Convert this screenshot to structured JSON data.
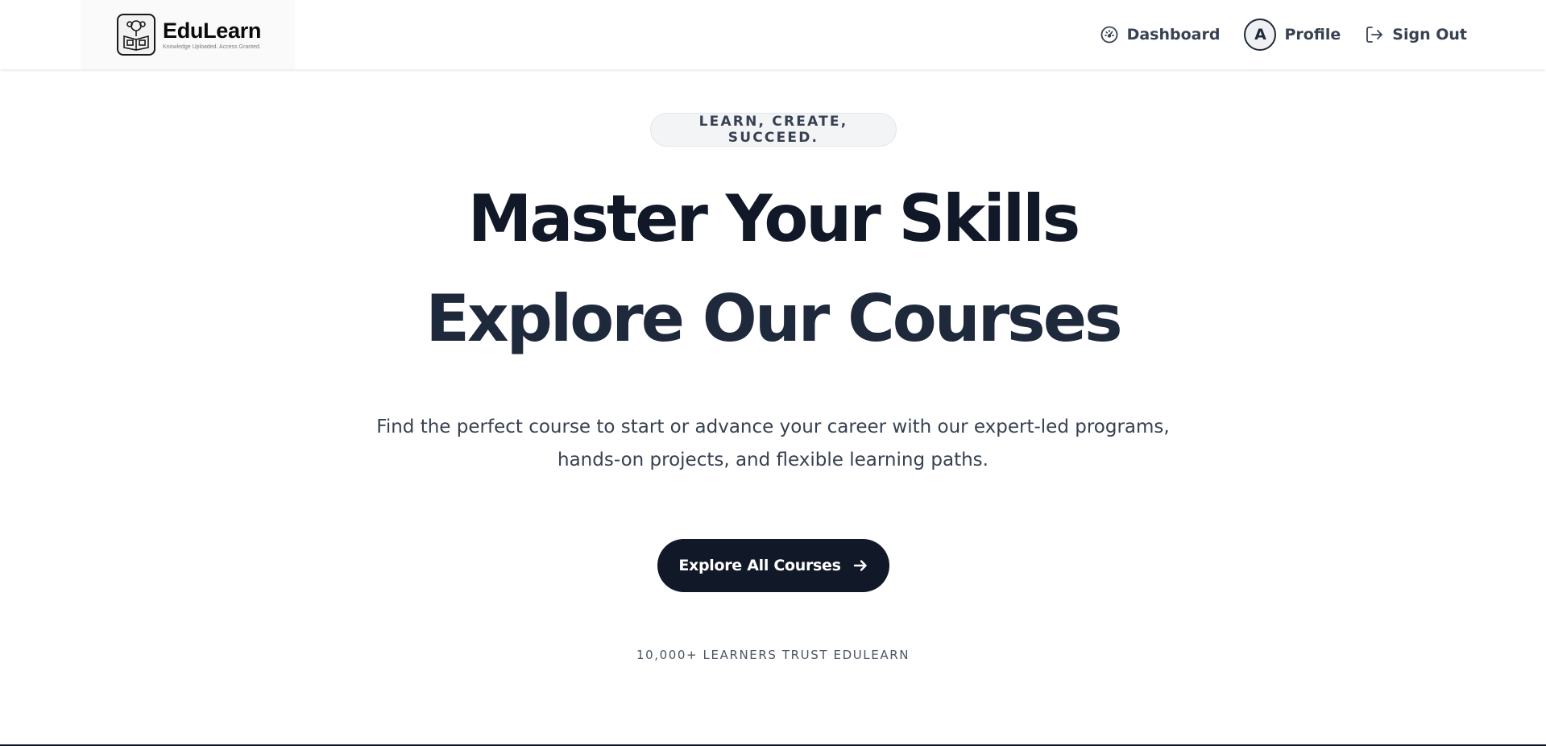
{
  "brand": {
    "name": "EduLearn",
    "tagline": "Knowledge Uploaded. Access Granted."
  },
  "nav": {
    "dashboard_label": "Dashboard",
    "profile_label": "Profile",
    "avatar_initial": "A",
    "signout_label": "Sign Out",
    "icons": {
      "dashboard": "gauge-icon",
      "signout": "sign-out-icon"
    }
  },
  "hero": {
    "eyebrow": "LEARN, CREATE, SUCCEED.",
    "title_line1": "Master Your Skills",
    "title_line2": "Explore Our Courses",
    "description": "Find the perfect course to start or advance your career with our expert-led programs, hands-on projects, and flexible learning paths.",
    "cta_label": "Explore All Courses",
    "trust_text": "10,000+ LEARNERS TRUST EDULEARN"
  },
  "colors": {
    "primary_dark": "#111827",
    "text": "#374151",
    "pill_bg": "#f3f4f6"
  }
}
